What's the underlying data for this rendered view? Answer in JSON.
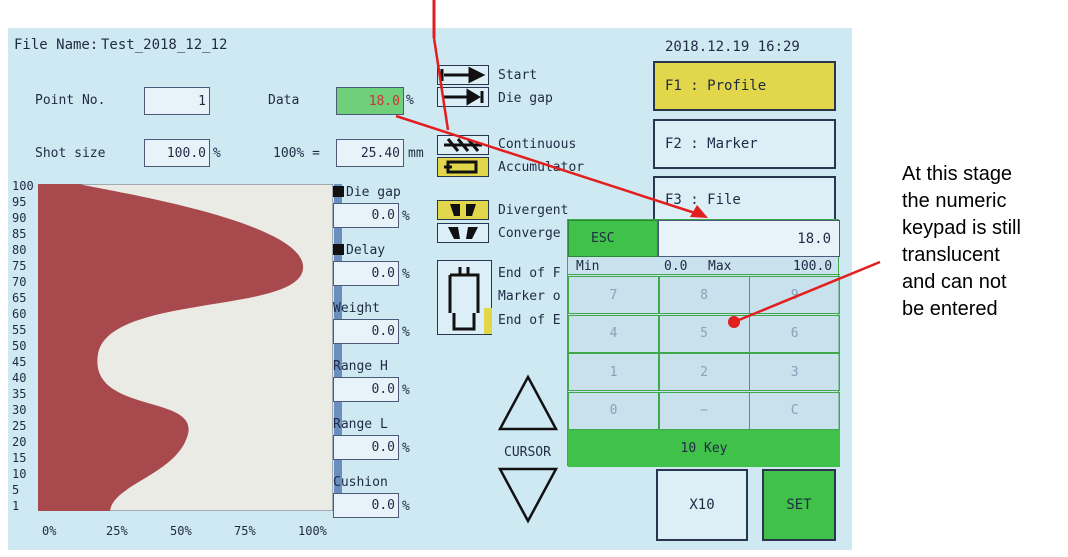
{
  "header": {
    "file_label": "File Name:",
    "file_name": "Test_2018_12_12",
    "datetime": "2018.12.19 16:29"
  },
  "fields": {
    "point_label": "Point No.",
    "point_value": "1",
    "data_label": "Data",
    "data_value": "18.0",
    "data_unit": "%",
    "shot_label": "Shot size",
    "shot_value": "100.0",
    "shot_unit": "%",
    "hundred_label": "100% =",
    "hundred_value": "25.40",
    "hundred_unit": "mm"
  },
  "chart": {
    "y_ticks": [
      "100",
      "95",
      "90",
      "85",
      "80",
      "75",
      "70",
      "65",
      "60",
      "55",
      "50",
      "45",
      "40",
      "35",
      "30",
      "25",
      "20",
      "15",
      "10",
      "5",
      "1"
    ],
    "x_ticks": [
      "0%",
      "25%",
      "50%",
      "75%",
      "100%"
    ],
    "fill_color": "#a84a4d"
  },
  "readouts": [
    {
      "label": "Die gap",
      "value": "0.0",
      "unit": "%",
      "marker": true
    },
    {
      "label": "Delay",
      "value": "0.0",
      "unit": "%",
      "marker": true
    },
    {
      "label": "Weight",
      "value": "0.0",
      "unit": "%",
      "marker": false
    },
    {
      "label": "Range H",
      "value": "0.0",
      "unit": "%",
      "marker": false
    },
    {
      "label": "Range L",
      "value": "0.0",
      "unit": "%",
      "marker": false
    },
    {
      "label": "Cushion",
      "value": "0.0",
      "unit": "%",
      "marker": false
    }
  ],
  "controls": {
    "start": "Start",
    "die_gap": "Die gap",
    "continuous": "Continuous",
    "accumulator": "Accumulator",
    "divergent": "Divergent",
    "convergent": "Converge",
    "end_of_f": "End of F",
    "marker_o": "Marker o",
    "end_of_e": "End of E",
    "cursor": "CURSOR"
  },
  "function_keys": {
    "f1": "F1 : Profile",
    "f2": "F2 : Marker",
    "f3": "F3 : File"
  },
  "keypad": {
    "esc": "ESC",
    "display": "18.0",
    "min_label": "Min",
    "min_value": "0.0",
    "max_label": "Max",
    "max_value": "100.0",
    "keys": [
      "7",
      "8",
      "9",
      "4",
      "5",
      "6",
      "1",
      "2",
      "3",
      "0",
      "−",
      "C"
    ],
    "title": "10 Key",
    "x10": "X10",
    "set": "SET"
  },
  "annotation": {
    "lines": [
      "At this stage",
      "the numeric",
      "keypad is still",
      "translucent",
      "and can not",
      "be entered"
    ]
  },
  "colors": {
    "screen_bg": "#cfe9f2",
    "highlight_yellow": "#e2d64a",
    "keypad_green": "#3fc14a",
    "data_green": "#6fcf7a",
    "arrow_red": "#e21e1e"
  }
}
